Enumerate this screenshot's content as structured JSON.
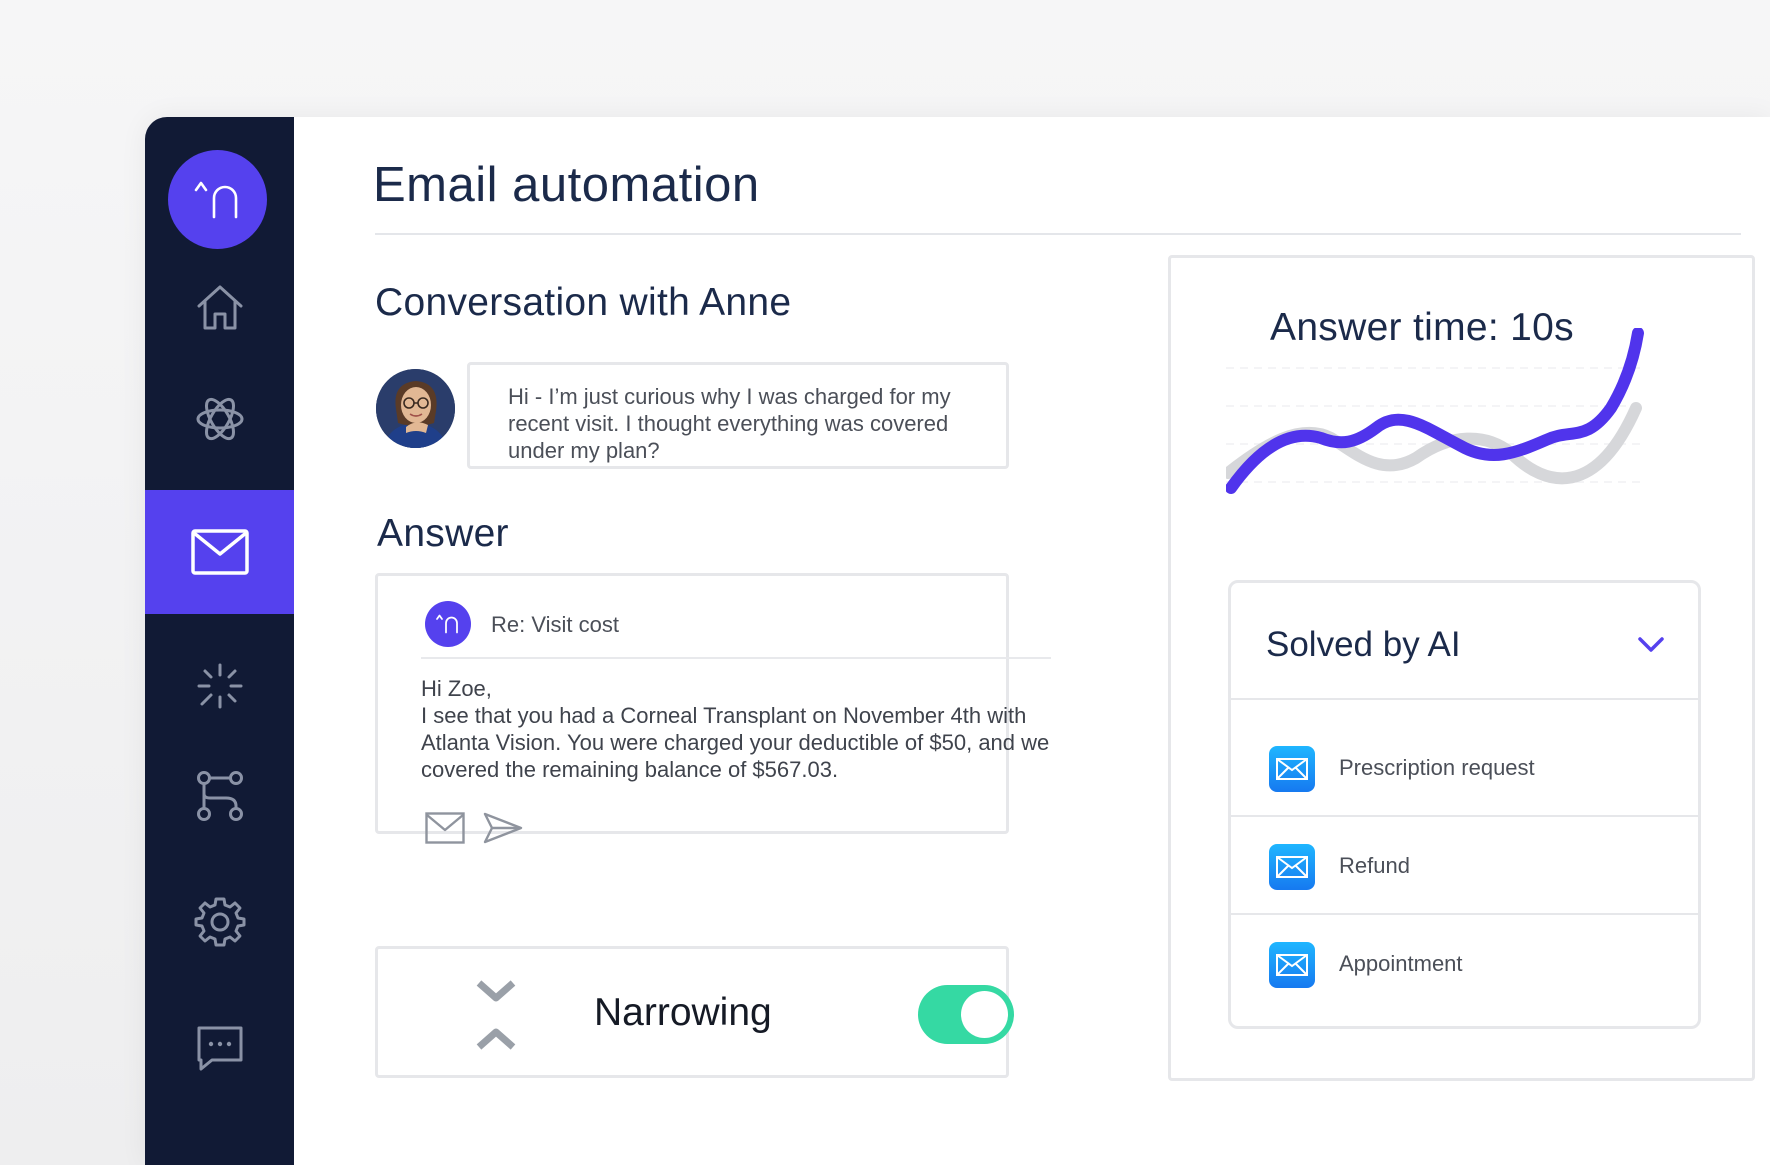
{
  "page": {
    "title": "Email automation"
  },
  "colors": {
    "sidebar": "#111a35",
    "accent": "#5541ee",
    "toggle_on": "#35d9a3",
    "title_text": "#1b2a4a"
  },
  "sidebar": {
    "logo_icon": "brand-logo-icon",
    "items": [
      {
        "icon": "home-icon",
        "active": false
      },
      {
        "icon": "atom-icon",
        "active": false
      },
      {
        "icon": "mail-icon",
        "active": true
      },
      {
        "icon": "sparkle-icon",
        "active": false
      },
      {
        "icon": "workflow-icon",
        "active": false
      },
      {
        "icon": "gear-icon",
        "active": false
      },
      {
        "icon": "chat-icon",
        "active": false
      }
    ]
  },
  "conversation": {
    "title": "Conversation with Anne",
    "message": "Hi - I’m just curious why I was charged for my recent visit. I thought everything was covered under my plan?"
  },
  "answer": {
    "title": "Answer",
    "subject": "Re: Visit cost",
    "greeting": "Hi Zoe,",
    "body": "I see that you had a Corneal Transplant on November 4th with Atlanta Vision. You were charged your deductible of $50, and we covered the remaining balance of $567.03."
  },
  "narrowing": {
    "label": "Narrowing",
    "enabled": true
  },
  "chart": {
    "title": "Answer time: 10s"
  },
  "solved": {
    "title": "Solved by AI",
    "items": [
      {
        "label": "Prescription request"
      },
      {
        "label": "Refund"
      },
      {
        "label": "Appointment"
      }
    ]
  }
}
